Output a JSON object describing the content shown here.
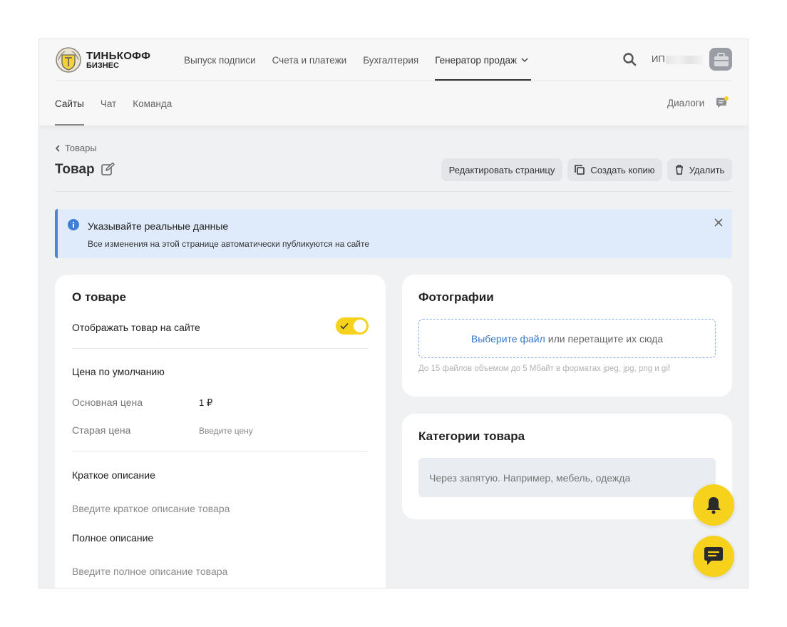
{
  "brand": {
    "line1": "ТИНЬКОФФ",
    "line2": "БИЗНЕС"
  },
  "topnav": [
    {
      "label": "Выпуск подписи"
    },
    {
      "label": "Счета и платежи"
    },
    {
      "label": "Бухгалтерия"
    },
    {
      "label": "Генератор продаж",
      "active": true
    }
  ],
  "user": {
    "prefix": "ИП"
  },
  "subnav": [
    {
      "label": "Сайты",
      "active": true
    },
    {
      "label": "Чат"
    },
    {
      "label": "Команда"
    }
  ],
  "dialogs_label": "Диалоги",
  "breadcrumb": {
    "back_label": "Товары"
  },
  "page": {
    "title": "Товар"
  },
  "actions": {
    "edit_page": "Редактировать страницу",
    "copy": "Создать копию",
    "delete": "Удалить"
  },
  "alert": {
    "title": "Указывайте реальные данные",
    "text": "Все изменения на этой странице автоматически публикуются на сайте"
  },
  "product": {
    "title": "О товаре",
    "show_on_site_label": "Отображать товар на сайте",
    "show_on_site": true,
    "price_section": "Цена по умолчанию",
    "base_price_label": "Основная цена",
    "base_price_value": "1 ₽",
    "old_price_label": "Старая цена",
    "old_price_placeholder": "Введите цену",
    "short_desc_label": "Краткое описание",
    "short_desc_placeholder": "Введите краткое описание товара",
    "full_desc_label": "Полное описание",
    "full_desc_placeholder": "Введите полное описание товара"
  },
  "photos": {
    "title": "Фотографии",
    "choose_file": "Выберите файл",
    "drop_text": "или перетащите их сюда",
    "hint": "До 15 файлов объемом до 5 Мбайт в форматах jpeg, jpg, png и gif"
  },
  "categories": {
    "title": "Категории товара",
    "placeholder": "Через запятую. Например, мебель, одежда"
  },
  "colors": {
    "accent": "#f7d21c",
    "info_bg": "#dfebfb",
    "info_border": "#4a86d8",
    "link": "#3a78c9"
  },
  "icons": [
    "search-icon",
    "chevron-down-icon",
    "avatar",
    "chat-bubble-icon",
    "chevron-left-icon",
    "edit-icon",
    "copy-icon",
    "trash-icon",
    "info-icon",
    "close-icon",
    "check-icon",
    "bell-icon",
    "chat-icon"
  ]
}
